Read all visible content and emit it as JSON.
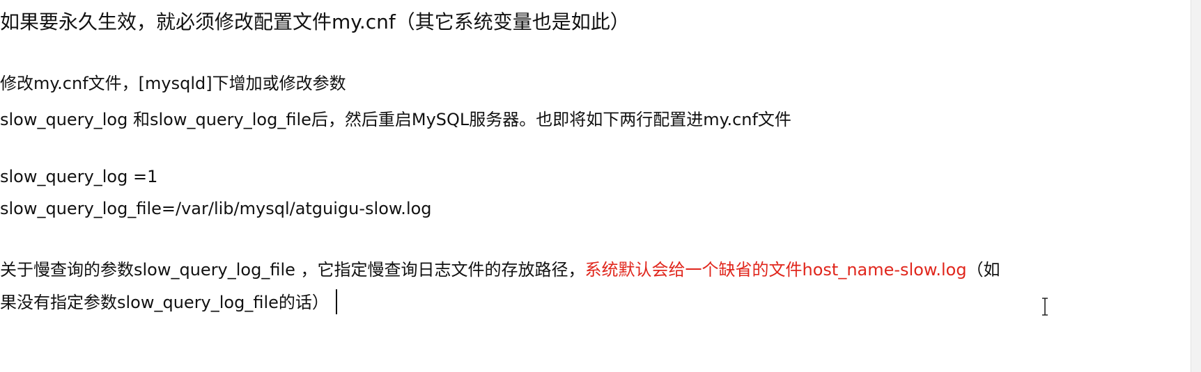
{
  "document": {
    "title": "如果要永久生效，就必须修改配置文件my.cnf（其它系统变量也是如此）",
    "para1": "修改my.cnf文件，[mysqld]下增加或修改参数",
    "para2": "slow_query_log 和slow_query_log_file后，然后重启MySQL服务器。也即将如下两行配置进my.cnf文件",
    "config_line1": "slow_query_log =1",
    "config_line2": "slow_query_log_file=/var/lib/mysql/atguigu-slow.log",
    "para3_part1": "关于慢查询的参数slow_query_log_file ，它指定慢查询日志文件的存放路径，",
    "para3_red": "系统默认会给一个缺省的文件host_name-slow.log",
    "para3_part2": "（如",
    "para3_line2": "果没有指定参数slow_query_log_file的话）"
  },
  "colors": {
    "text": "#111111",
    "highlight": "#e0261c",
    "background": "#ffffff"
  }
}
